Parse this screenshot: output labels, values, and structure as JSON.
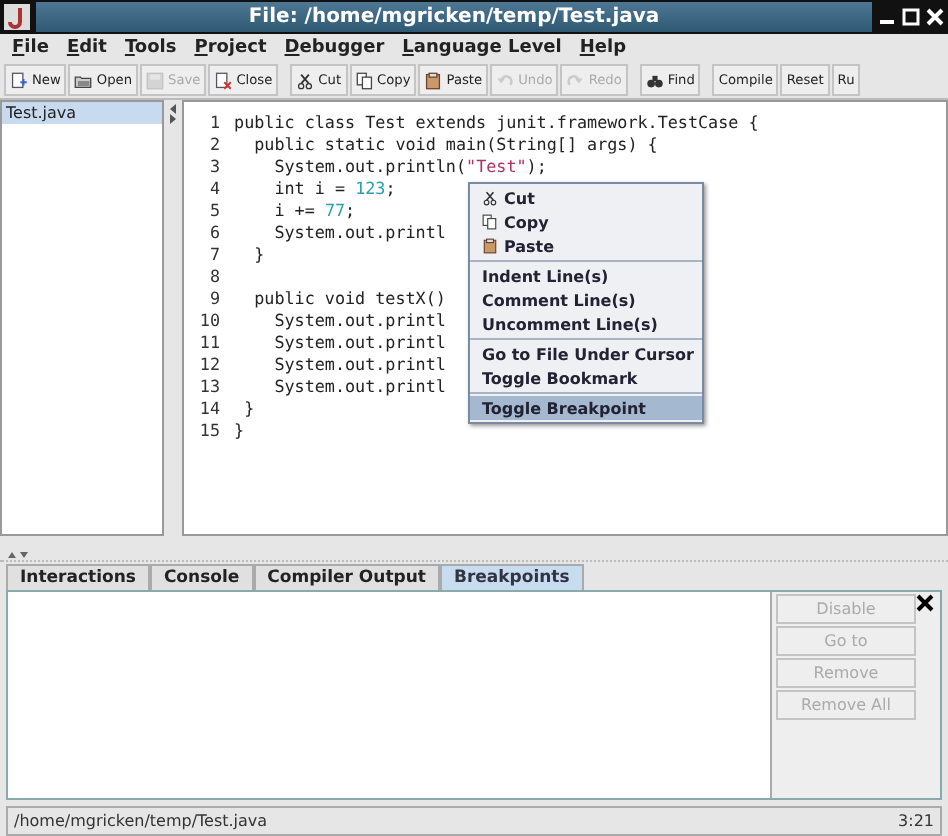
{
  "window": {
    "title": "File: /home/mgricken/temp/Test.java"
  },
  "menu_bar": [
    {
      "label": "File"
    },
    {
      "label": "Edit"
    },
    {
      "label": "Tools"
    },
    {
      "label": "Project"
    },
    {
      "label": "Debugger"
    },
    {
      "label": "Language Level"
    },
    {
      "label": "Help"
    }
  ],
  "toolbar": [
    [
      {
        "label": "New",
        "disabled": false
      },
      {
        "label": "Open",
        "disabled": false
      },
      {
        "label": "Save",
        "disabled": true
      },
      {
        "label": "Close",
        "disabled": false
      }
    ],
    [
      {
        "label": "Cut",
        "disabled": false
      },
      {
        "label": "Copy",
        "disabled": false
      },
      {
        "label": "Paste",
        "disabled": false
      },
      {
        "label": "Undo",
        "disabled": true
      },
      {
        "label": "Redo",
        "disabled": true
      }
    ],
    [
      {
        "label": "Find",
        "disabled": false
      }
    ],
    [
      {
        "label": "Compile",
        "disabled": false
      },
      {
        "label": "Reset",
        "disabled": false
      },
      {
        "label": "Ru",
        "disabled": false
      }
    ]
  ],
  "files": [
    {
      "name": "Test.java",
      "selected": true
    }
  ],
  "editor": {
    "lines": [
      {
        "number": "1",
        "segments": [
          {
            "kind": "plain",
            "text": "public class Test extends junit.framework.TestCase {"
          }
        ]
      },
      {
        "number": "2",
        "segments": [
          {
            "kind": "plain",
            "text": "  public static void main(String[] args) {"
          }
        ]
      },
      {
        "number": "3",
        "segments": [
          {
            "kind": "plain",
            "text": "    System.out.println("
          },
          {
            "kind": "string",
            "text": "\"Test\""
          },
          {
            "kind": "plain",
            "text": ");"
          }
        ]
      },
      {
        "number": "4",
        "segments": [
          {
            "kind": "plain",
            "text": "    int i = "
          },
          {
            "kind": "number",
            "text": "123"
          },
          {
            "kind": "plain",
            "text": ";"
          }
        ]
      },
      {
        "number": "5",
        "segments": [
          {
            "kind": "plain",
            "text": "    i += "
          },
          {
            "kind": "number",
            "text": "77"
          },
          {
            "kind": "plain",
            "text": ";"
          }
        ]
      },
      {
        "number": "6",
        "segments": [
          {
            "kind": "plain",
            "text": "    System.out.printl"
          }
        ]
      },
      {
        "number": "7",
        "segments": [
          {
            "kind": "plain",
            "text": "  }"
          }
        ]
      },
      {
        "number": "8"
      },
      {
        "number": "9",
        "segments": [
          {
            "kind": "plain",
            "text": "  public void testX()"
          }
        ]
      },
      {
        "number": "10",
        "segments": [
          {
            "kind": "plain",
            "text": "    System.out.printl"
          }
        ]
      },
      {
        "number": "11",
        "segments": [
          {
            "kind": "plain",
            "text": "    System.out.printl"
          }
        ]
      },
      {
        "number": "12",
        "segments": [
          {
            "kind": "plain",
            "text": "    System.out.printl"
          }
        ]
      },
      {
        "number": "13",
        "segments": [
          {
            "kind": "plain",
            "text": "    System.out.printl"
          }
        ]
      },
      {
        "number": "14",
        "segments": [
          {
            "kind": "plain",
            "text": " }"
          }
        ]
      },
      {
        "number": "15",
        "segments": [
          {
            "kind": "plain",
            "text": "}"
          }
        ]
      }
    ]
  },
  "context_menu": [
    [
      {
        "label": "Cut",
        "selected": false
      },
      {
        "label": "Copy",
        "selected": false
      },
      {
        "label": "Paste",
        "selected": false
      }
    ],
    [
      {
        "label": "Indent Line(s)",
        "selected": false
      },
      {
        "label": "Comment Line(s)",
        "selected": false
      },
      {
        "label": "Uncomment Line(s)",
        "selected": false
      }
    ],
    [
      {
        "label": "Go to File Under Cursor",
        "selected": false
      },
      {
        "label": "Toggle Bookmark",
        "selected": false
      }
    ],
    [
      {
        "label": "Toggle Breakpoint",
        "selected": true
      }
    ]
  ],
  "bottom_tabs": [
    {
      "label": "Interactions",
      "selected": false
    },
    {
      "label": "Console",
      "selected": false
    },
    {
      "label": "Compiler Output",
      "selected": false
    },
    {
      "label": "Breakpoints",
      "selected": true
    }
  ],
  "breakpoint_buttons": [
    {
      "label": "Disable",
      "disabled": true
    },
    {
      "label": "Go to",
      "disabled": true
    },
    {
      "label": "Remove",
      "disabled": true
    },
    {
      "label": "Remove All",
      "disabled": true
    }
  ],
  "status_bar": {
    "path": "/home/mgricken/temp/Test.java",
    "position": "3:21"
  }
}
